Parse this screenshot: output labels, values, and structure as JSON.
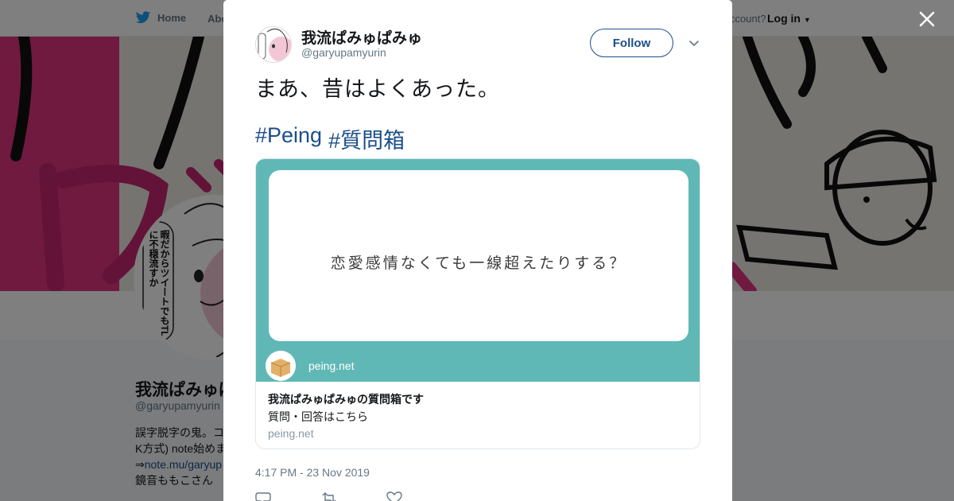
{
  "colors": {
    "accent": "#1b4e8a",
    "twitter_blue": "#1da1f2",
    "card_teal": "#60b8b6",
    "banner_pink": "#e0347e"
  },
  "nav": {
    "home_label": "Home",
    "about_label": "Abo",
    "account_text": "ccount?",
    "login_label": "Log in"
  },
  "profile": {
    "name": "我流ぱみゅぱみゅ",
    "handle": "@garyupamyurin",
    "bio_line1": "誤字脱字の鬼。コ",
    "bio_line2": "K方式) note始めま",
    "bio_line3_prefix": "⇒",
    "bio_line3_link": "note.mu/garyup",
    "bio_line4": "鏡音ももこさん",
    "avatar_caption": "暇だからツイートでもTLに不穏流すか"
  },
  "tweet": {
    "name": "我流ぱみゅぱみゅ",
    "handle": "@garyupamyurin",
    "follow_label": "Follow",
    "text": "まあ、昔はよくあった。",
    "hashtags": [
      "#Peing",
      "#質問箱"
    ],
    "time": "4:17 PM - 23 Nov 2019"
  },
  "card": {
    "question": "恋愛感情なくても一線超えたりする？",
    "site_label": "peing.net",
    "title": "我流ぱみゅぱみゅの質問箱です",
    "description": "質問・回答はこちら",
    "url": "peing.net"
  },
  "icons": [
    "twitter-bird-icon",
    "close-icon",
    "chevron-down-icon",
    "reply-icon",
    "retweet-icon",
    "like-icon",
    "box-logo-icon"
  ]
}
